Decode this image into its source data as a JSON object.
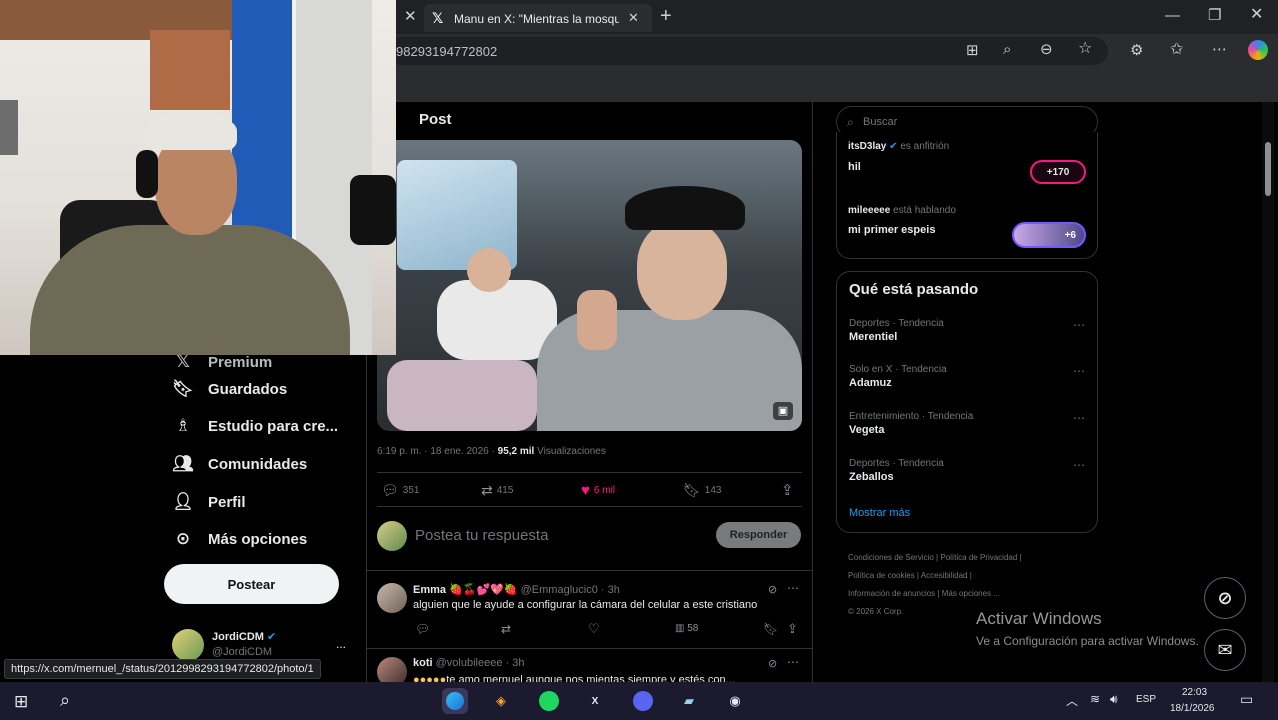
{
  "browser": {
    "tab_title": "Manu en X: \"Mientras la mosquita",
    "url": "98293194772802",
    "status_url": "https://x.com/mernuel_/status/2012998293194772802/photo/1",
    "icons": [
      "close-icon",
      "new-tab-icon",
      "minimize-icon",
      "restore-icon",
      "window-close-icon",
      "extensions-icon",
      "zoom-icon",
      "favorite-icon",
      "more-icon",
      "copilot-icon"
    ]
  },
  "sidebar": {
    "partial_label": "Premium",
    "items": [
      {
        "label": "Guardados",
        "icon": "bookmark-icon"
      },
      {
        "label": "Estudio para cre...",
        "icon": "studio-icon"
      },
      {
        "label": "Comunidades",
        "icon": "communities-icon"
      },
      {
        "label": "Perfil",
        "icon": "profile-icon"
      },
      {
        "label": "Más opciones",
        "icon": "more-options-icon"
      }
    ],
    "post_button": "Postear",
    "account": {
      "name": "JordiCDM",
      "handle": "@JordiCDM",
      "more": "..."
    }
  },
  "post": {
    "header": "Post",
    "timestamp": "6:19 p. m. · 18 ene. 2026 ·",
    "views_count": "95,2 mil",
    "views_label": "Visualizaciones",
    "stats": {
      "replies": "351",
      "reposts": "415",
      "likes": "6 mil",
      "bookmarks": "143"
    },
    "reply_placeholder": "Postea tu respuesta",
    "reply_button": "Responder"
  },
  "replies": [
    {
      "name": "Emma",
      "emojis": "🍓🍒💕💖🍓",
      "handle": "@Emmaglucic0",
      "time": "· 3h",
      "text": "alguien que le ayude a configurar la cámara del celular a este cristiano",
      "views": "58"
    },
    {
      "name": "koti",
      "emojis": "",
      "handle": "@volubileeee",
      "time": "· 3h",
      "text": "te amo mernuel aunque nos mientas siempre y estés con...",
      "views": ""
    }
  ],
  "right": {
    "search_placeholder": "Buscar",
    "spaces": [
      {
        "host": "itsD3lay",
        "role": "es anfitrión",
        "title": "hil",
        "badge": "+170"
      },
      {
        "host": "mileeeee",
        "role": "está hablando",
        "title": "mi primer espeis",
        "badge": "+6"
      }
    ],
    "trends_title": "Qué está pasando",
    "trends": [
      {
        "category": "Deportes · Tendencia",
        "name": "Merentiel"
      },
      {
        "category": "Solo en X · Tendencia",
        "name": "Adamuz"
      },
      {
        "category": "Entretenimiento · Tendencia",
        "name": "Vegeta"
      },
      {
        "category": "Deportes · Tendencia",
        "name": "Zeballos"
      }
    ],
    "show_more": "Mostrar más",
    "footer_links": [
      "Condiciones de Servicio",
      "Política de Privacidad",
      "Política de cookies",
      "Accesibilidad",
      "Información de anuncios",
      "Más opciones ...",
      "© 2026 X Corp."
    ]
  },
  "watermark": {
    "title": "Activar Windows",
    "subtitle": "Ve a Configuración para activar Windows."
  },
  "taskbar": {
    "lang": "ESP",
    "time": "22:03",
    "date": "18/1/2026"
  },
  "colors": {
    "like": "#f91880",
    "verified": "#1d9bf0",
    "link": "#1d9bf0",
    "taskbar": "#1c1a2e"
  }
}
